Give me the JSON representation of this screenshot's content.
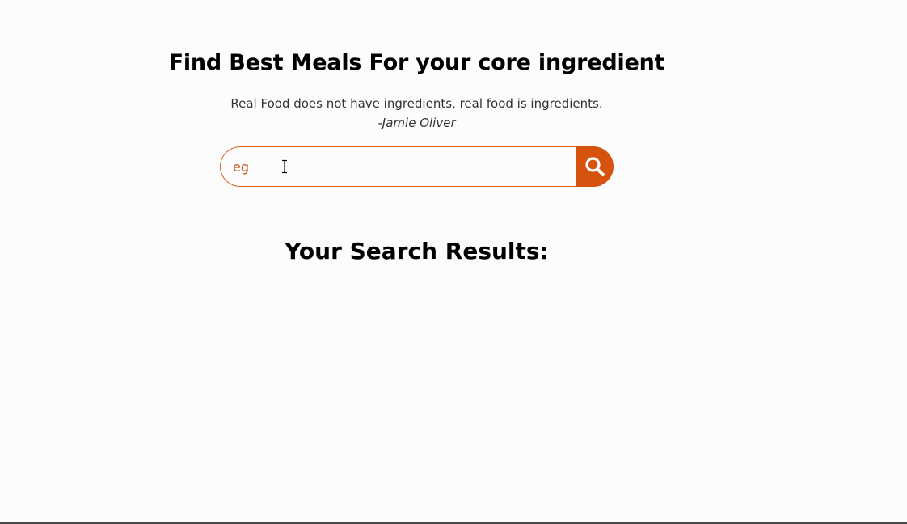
{
  "header": {
    "title": "Find Best Meals For your core ingredient",
    "quote": "Real Food does not have ingredients, real food is ingredients.",
    "author": "-Jamie Oliver"
  },
  "search": {
    "value": "eg",
    "button_icon": "search-icon"
  },
  "results": {
    "title": "Your Search Results:"
  },
  "colors": {
    "accent": "#d5530f",
    "input_border": "#d9621b",
    "input_text": "#c4541c",
    "background": "#fcfcfc"
  }
}
